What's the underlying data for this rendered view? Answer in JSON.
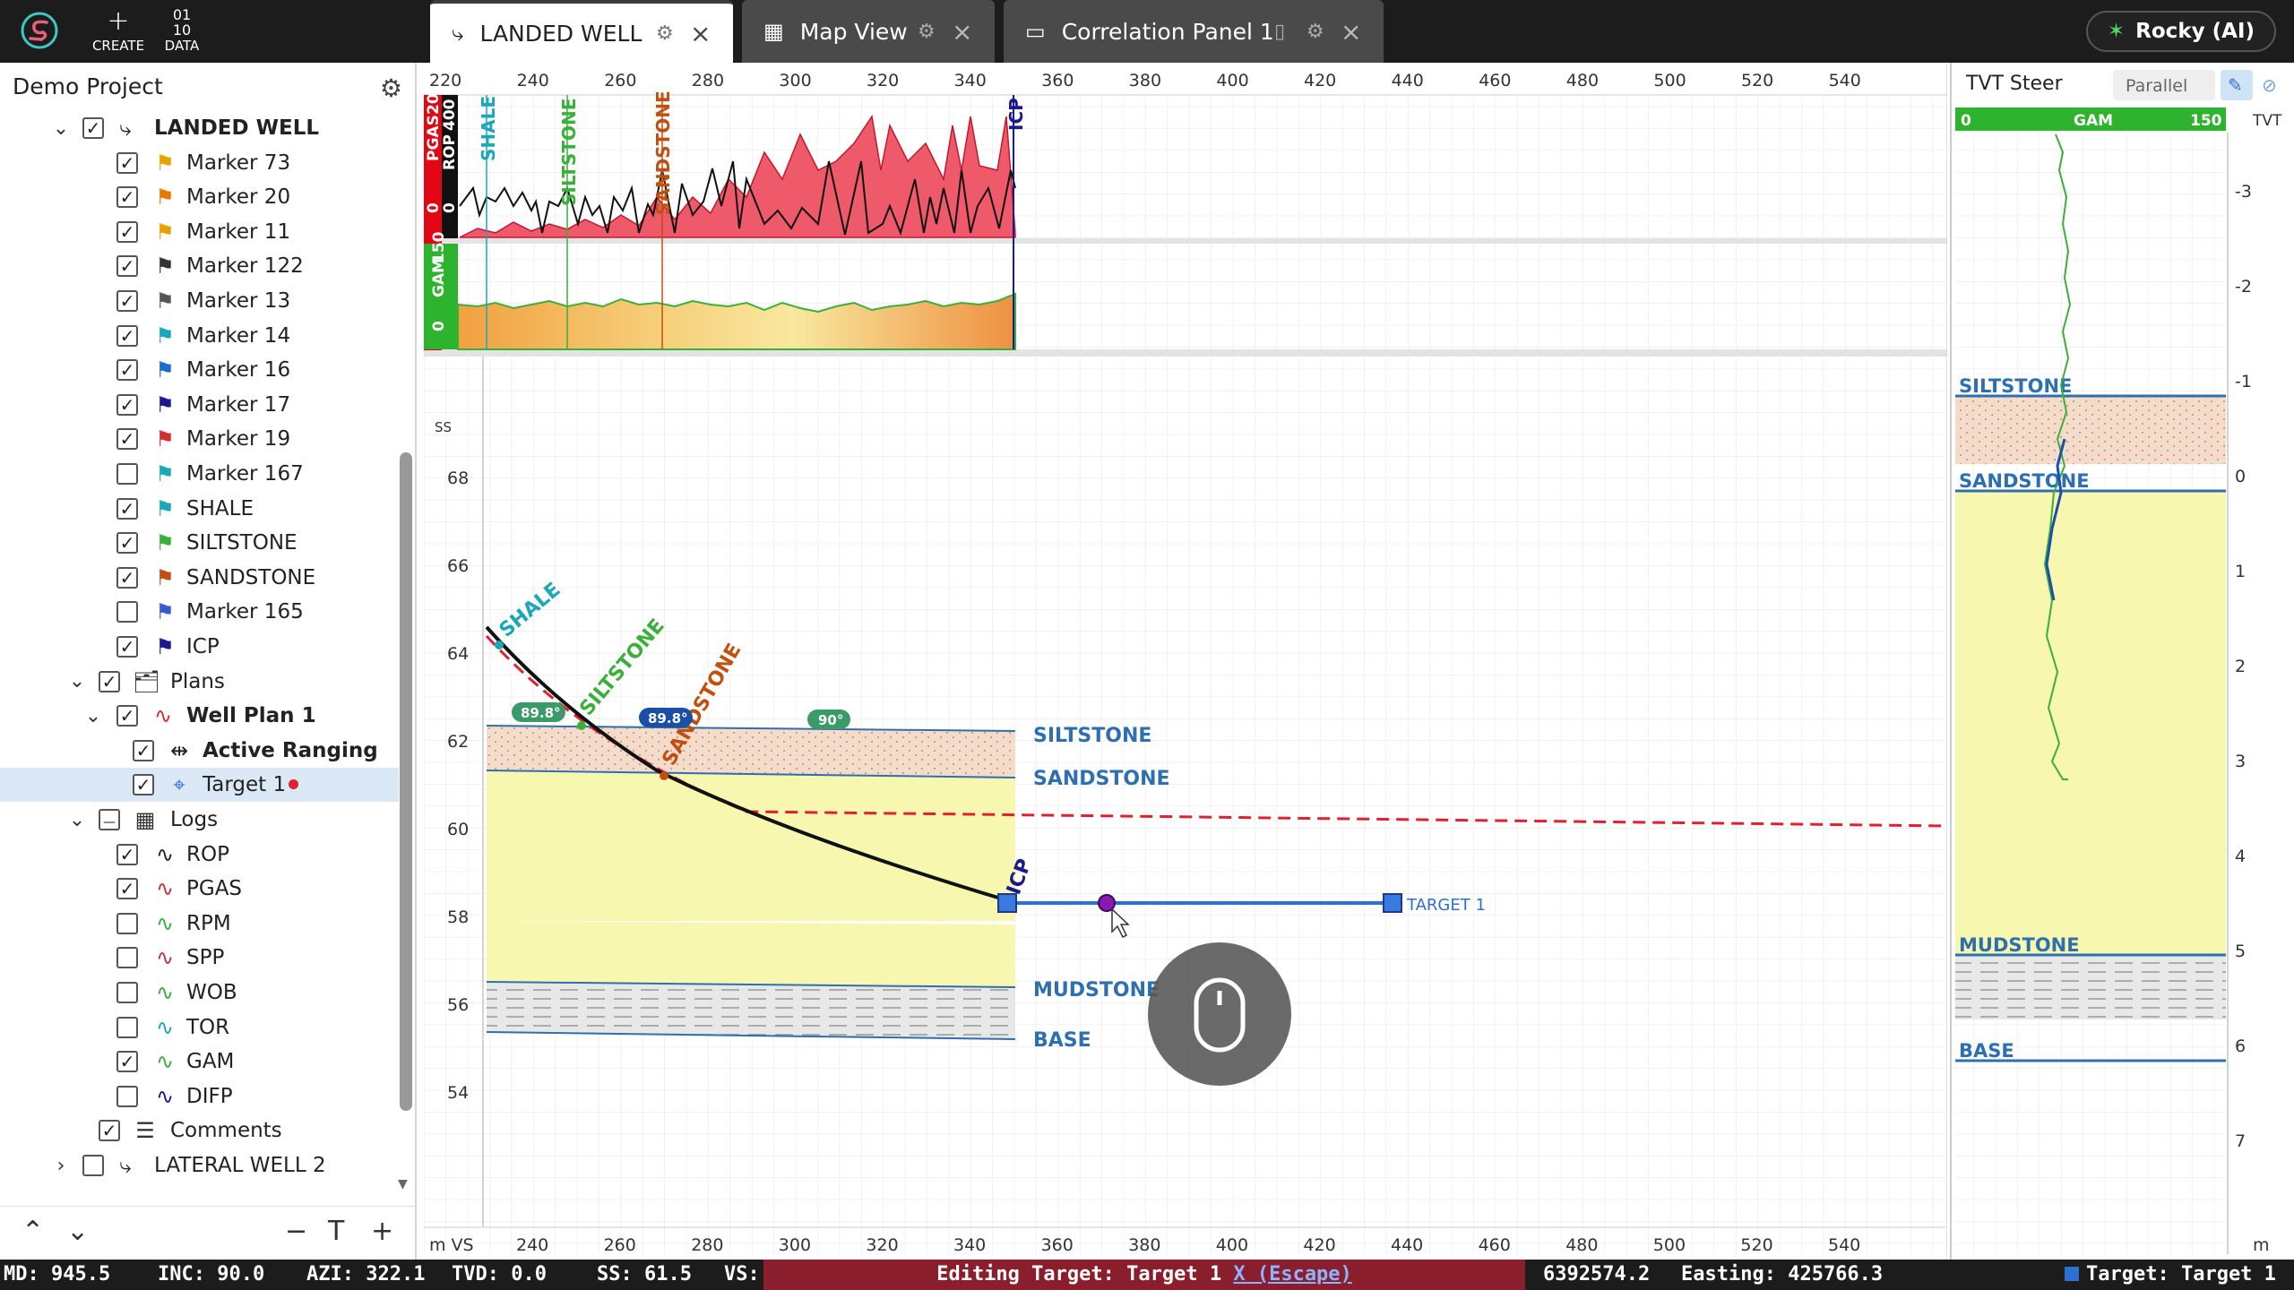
{
  "app": {
    "logo": "S"
  },
  "toolbar": {
    "create_label": "CREATE",
    "data_icon": "01\n10",
    "data_label": "DATA"
  },
  "tabs": [
    {
      "label": "LANDED WELL",
      "active": true
    },
    {
      "label": "Map View",
      "active": false
    },
    {
      "label": "Correlation Panel 1",
      "active": false
    }
  ],
  "rocky": {
    "label": "Rocky (AI)"
  },
  "sidebar": {
    "project": "Demo Project",
    "well": "LANDED WELL",
    "markers": [
      "Marker 73",
      "Marker 20",
      "Marker 11",
      "Marker 122",
      "Marker 13",
      "Marker 14",
      "Marker 16",
      "Marker 17",
      "Marker 19",
      "Marker 167",
      "SHALE",
      "SILTSTONE",
      "SANDSTONE",
      "Marker 165",
      "ICP"
    ],
    "marker_colors": [
      "#e8a200",
      "#e87a00",
      "#e8a200",
      "#333",
      "#555",
      "#1aa8b8",
      "#1a6cc8",
      "#1a1a8a",
      "#d03030",
      "#1aa8b8",
      "#1aa8b8",
      "#3ab03a",
      "#c05010",
      "#3a5ad0",
      "#1a1a8a"
    ],
    "marker_checked": [
      true,
      true,
      true,
      true,
      true,
      true,
      true,
      true,
      true,
      false,
      true,
      true,
      true,
      false,
      true
    ],
    "plans_label": "Plans",
    "well_plan": "Well Plan 1",
    "active_ranging": "Active Ranging",
    "target": "Target 1",
    "logs_label": "Logs",
    "logs": [
      "ROP",
      "PGAS",
      "RPM",
      "SPP",
      "WOB",
      "TOR",
      "GAM",
      "DIFP"
    ],
    "log_colors": [
      "#222",
      "#d03030",
      "#3ab03a",
      "#c03050",
      "#3ab03a",
      "#1aa8b8",
      "#3ab03a",
      "#1a1a8a"
    ],
    "log_checked": [
      true,
      true,
      false,
      false,
      false,
      false,
      true,
      false
    ],
    "comments": "Comments",
    "lateral": "LATERAL WELL 2"
  },
  "chart": {
    "top_axis": [
      220,
      240,
      260,
      280,
      300,
      320,
      340,
      360,
      380,
      400,
      420,
      440,
      460,
      480,
      500,
      520,
      540
    ],
    "bottom_axis": [
      240,
      260,
      280,
      300,
      320,
      340,
      360,
      380,
      400,
      420,
      440,
      460,
      480,
      500,
      520,
      540
    ],
    "bottom_axis_label": "m VS",
    "ss_label": "SS",
    "ss_ticks": [
      68,
      66,
      64,
      62,
      60,
      58,
      56,
      54
    ],
    "track1": {
      "label1": "PGAS",
      "label2": "ROP",
      "max1": "20",
      "max2": "400",
      "min1": "0",
      "min2": "0"
    },
    "track2": {
      "label": "GAM",
      "max": "150",
      "min": "0"
    },
    "markers_vertical": [
      "SHALE",
      "SILTSTONE",
      "SANDSTONE",
      "ICP"
    ],
    "formations": [
      "SILTSTONE",
      "SANDSTONE",
      "MUDSTONE",
      "BASE"
    ],
    "angle_badges": [
      "89.8°",
      "89.8°",
      "90°"
    ],
    "target_label": "TARGET 1",
    "trajectory_markers": [
      "SHALE",
      "SILTSTONE",
      "SANDSTONE",
      "ICP"
    ]
  },
  "tvt": {
    "title": "TVT Steer",
    "mode": "Parallel",
    "gam_min": "0",
    "gam_label": "GAM",
    "gam_max": "150",
    "tvt_label": "TVT",
    "ticks": [
      "-3",
      "-2",
      "-1",
      "0",
      "1",
      "2",
      "3",
      "4",
      "5",
      "6",
      "7"
    ],
    "unit": "m",
    "formations": [
      "SILTSTONE",
      "SANDSTONE",
      "MUDSTONE",
      "BASE"
    ]
  },
  "status": {
    "md": "MD: 945.5",
    "inc": "INC: 90.0",
    "azi": "AZI: 322.1",
    "tvd": "TVD: 0.0",
    "ss": "SS: 61.5",
    "vs": "VS:",
    "editing": "Editing Target: Target 1",
    "escape": "X (Escape)",
    "northing": "6392574.2",
    "easting": "Easting: 425766.3",
    "target": "Target: Target 1"
  },
  "colors": {
    "accent": "#2e6fd0",
    "formation_text": "#2e6fb0",
    "pgas_fill": "#e8475c",
    "gam_fill": "#f4c060",
    "sand": "#f7f7b0",
    "silt": "#f6dcc8"
  }
}
